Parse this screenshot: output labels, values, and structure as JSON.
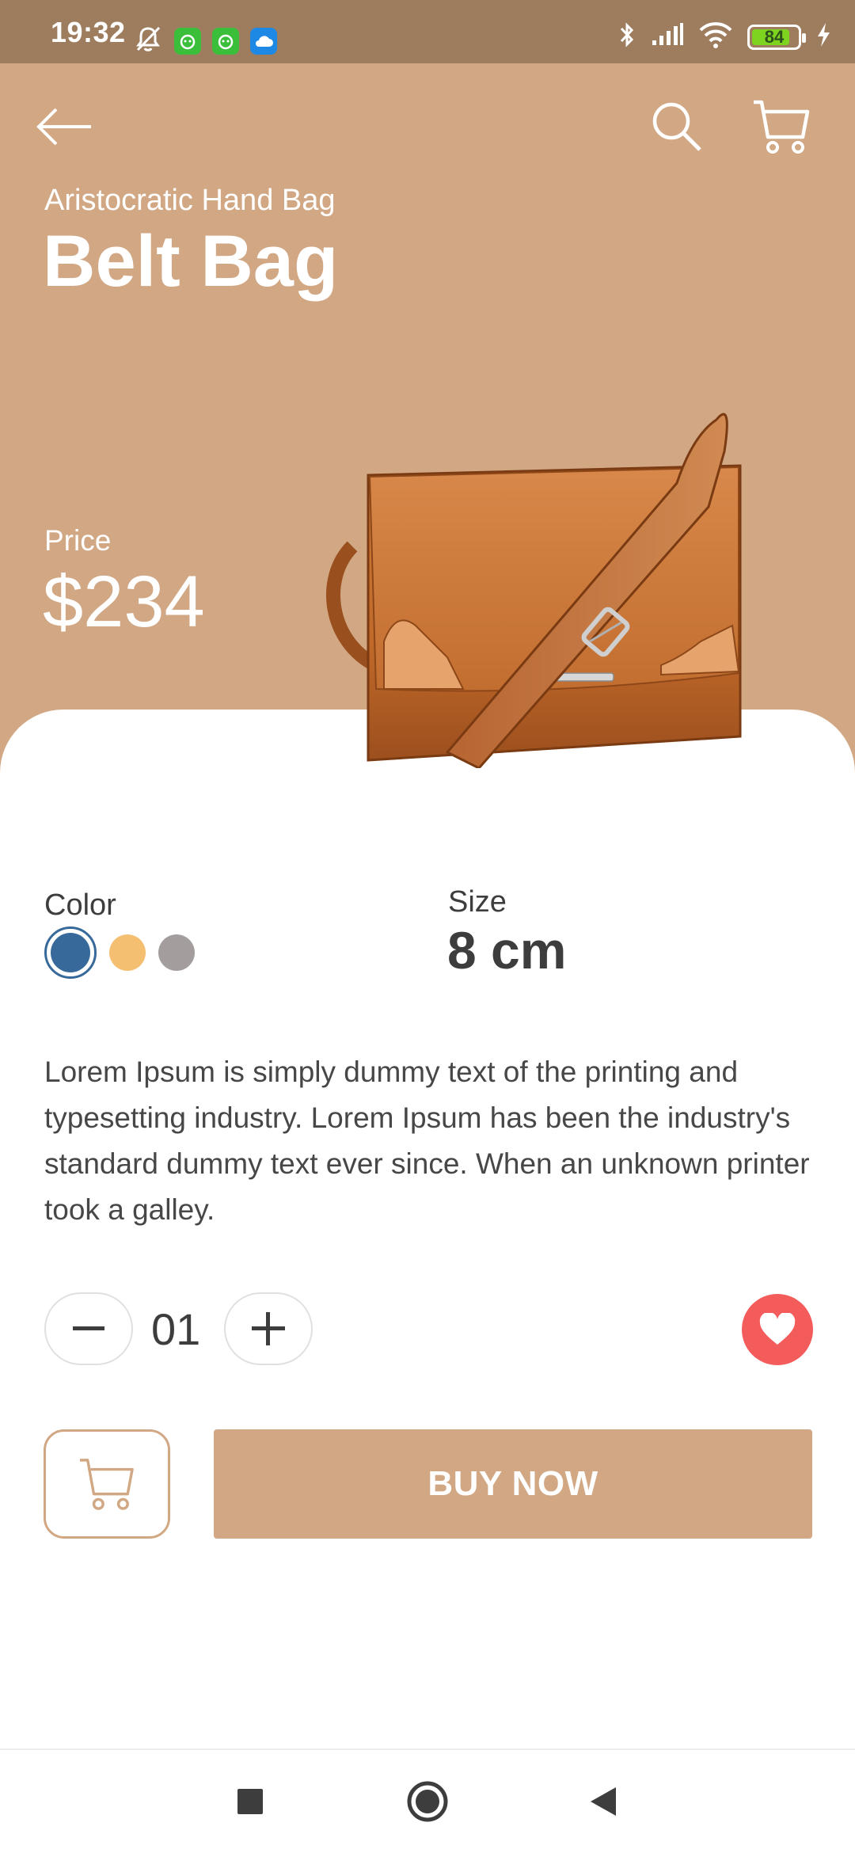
{
  "status_bar": {
    "time": "19:32",
    "battery_level": "84",
    "battery_fraction": 0.84,
    "icons_left": [
      "bell-off-icon",
      "app-green-icon",
      "app-green-icon",
      "cloud-icon"
    ],
    "icons_right": [
      "bluetooth-icon",
      "signal-icon",
      "wifi-icon",
      "battery-icon",
      "charging-icon"
    ]
  },
  "header": {
    "back_icon": "arrow-left-icon",
    "search_icon": "search-icon",
    "cart_icon": "cart-icon"
  },
  "product": {
    "subtitle": "Aristocratic Hand Bag",
    "title": "Belt Bag",
    "price_label": "Price",
    "price": "$234",
    "image": "brown-leather-shoulder-bag"
  },
  "options": {
    "color_label": "Color",
    "colors": [
      "#376a9a",
      "#f5bf72",
      "#a39d9e"
    ],
    "selected_color_index": 0,
    "size_label": "Size",
    "size_value": "8 cm"
  },
  "description": "Lorem Ipsum is simply dummy text of the printing and typesetting industry. Lorem Ipsum has been the industry's standard dummy text ever since. When an unknown printer took a galley.",
  "quantity": {
    "value": "01",
    "minus_icon": "minus-icon",
    "plus_icon": "plus-icon"
  },
  "favorite_icon": "heart-icon",
  "actions": {
    "cart_icon": "cart-icon",
    "buy_label": "BUY NOW"
  },
  "nav_bar": {
    "items": [
      "square-icon",
      "circle-icon",
      "triangle-back-icon"
    ]
  },
  "colors": {
    "accent": "#d1a784",
    "status_bar": "#9e7d5f",
    "favorite": "#f45c5c",
    "text_dark": "#3d3d3d"
  }
}
